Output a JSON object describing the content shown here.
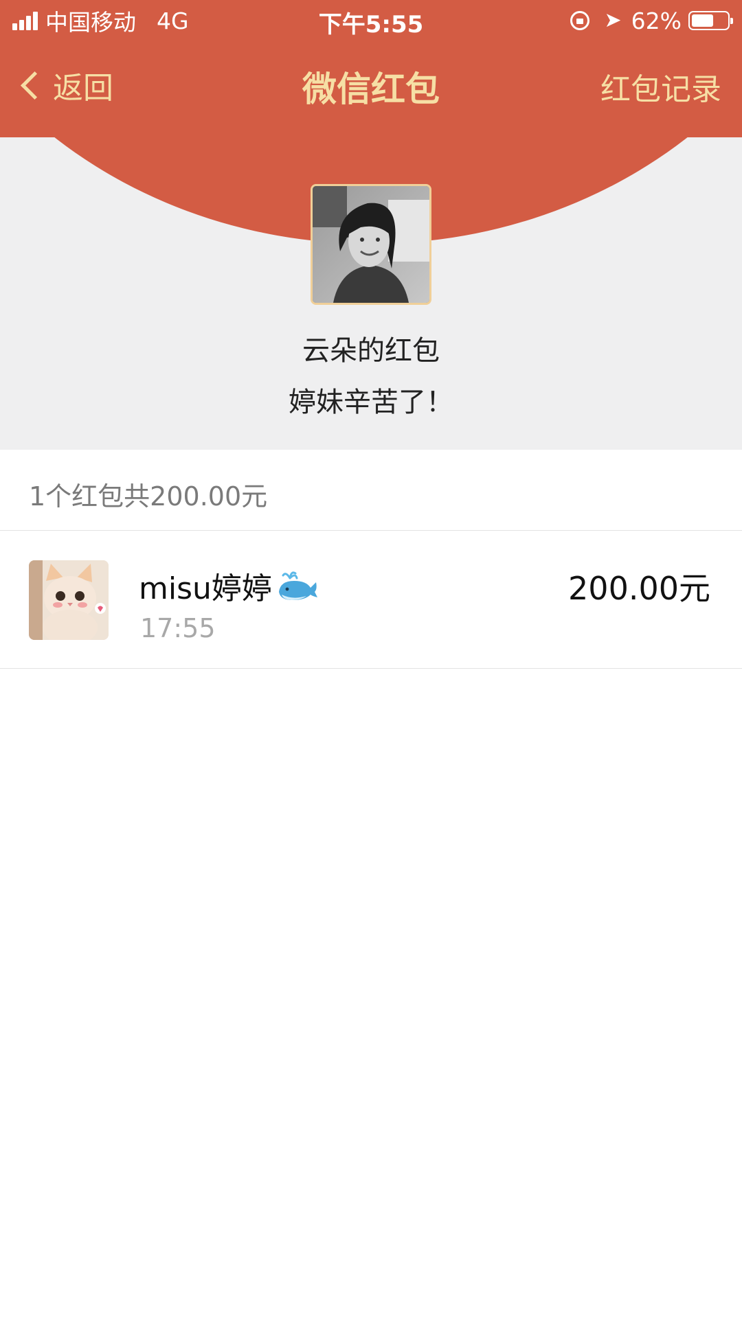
{
  "status_bar": {
    "carrier": "中国移动",
    "network": "4G",
    "time": "下午5:55",
    "battery": "62%",
    "battery_level": 0.62
  },
  "nav": {
    "back_label": "返回",
    "title": "微信红包",
    "records_label": "红包记录"
  },
  "sender": {
    "name": "云朵的红包",
    "message": "婷妹辛苦了！"
  },
  "summary": {
    "text": "1个红包共200.00元"
  },
  "records": [
    {
      "name": "misu婷婷",
      "time": "17:55",
      "amount": "200.00元"
    }
  ],
  "colors": {
    "header_red": "#d35c44",
    "gold_text": "#f6dfa5",
    "background_grey": "#efeff0"
  }
}
